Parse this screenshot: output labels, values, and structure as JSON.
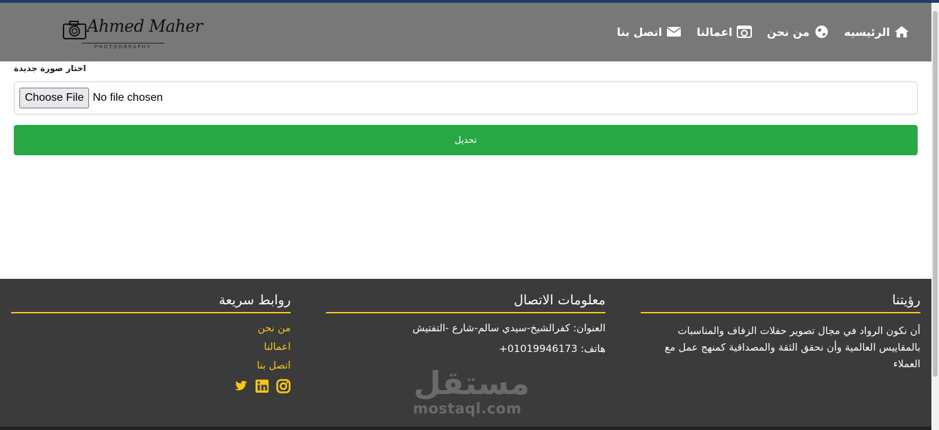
{
  "brand": {
    "name": "Ahmed Maher",
    "tagline": "PHOTOGRRAPHY"
  },
  "nav": {
    "items": [
      {
        "label": "الرئيسيه",
        "icon": "home-icon"
      },
      {
        "label": "من نحن",
        "icon": "globe-icon"
      },
      {
        "label": "اعمالنا",
        "icon": "camera-icon"
      },
      {
        "label": "اتصل بنا",
        "icon": "envelope-icon"
      }
    ]
  },
  "upload": {
    "label": "اختار صورة جديدة",
    "button": "Choose File",
    "status": "No file chosen",
    "submit": "تحديل"
  },
  "footer": {
    "vision": {
      "title": "رؤيتنا",
      "text": "أن نكون الرواد في مجال تصوير حفلات الزفاف والمناسبات بالمقاييس العالمية وأن نحقق الثقة والمصداقية كمنهج عمل مع العملاء"
    },
    "contact": {
      "title": "معلومات الاتصال",
      "address": "العنوان: كفرالشيخ-سيدي سالم-شارع -التفتيش",
      "phone": "هاتف: 01019946173+"
    },
    "links": {
      "title": "روابط سريعة",
      "items": [
        "من نحن",
        "اعمالنا",
        "اتصل بنا"
      ]
    }
  },
  "watermark": {
    "arabic": "مستقل",
    "latin": "mostaql.com"
  },
  "colors": {
    "header_bg": "#787878",
    "footer_bg": "#3b3b3b",
    "accent": "#f5c518",
    "submit_bg": "#28a745"
  }
}
